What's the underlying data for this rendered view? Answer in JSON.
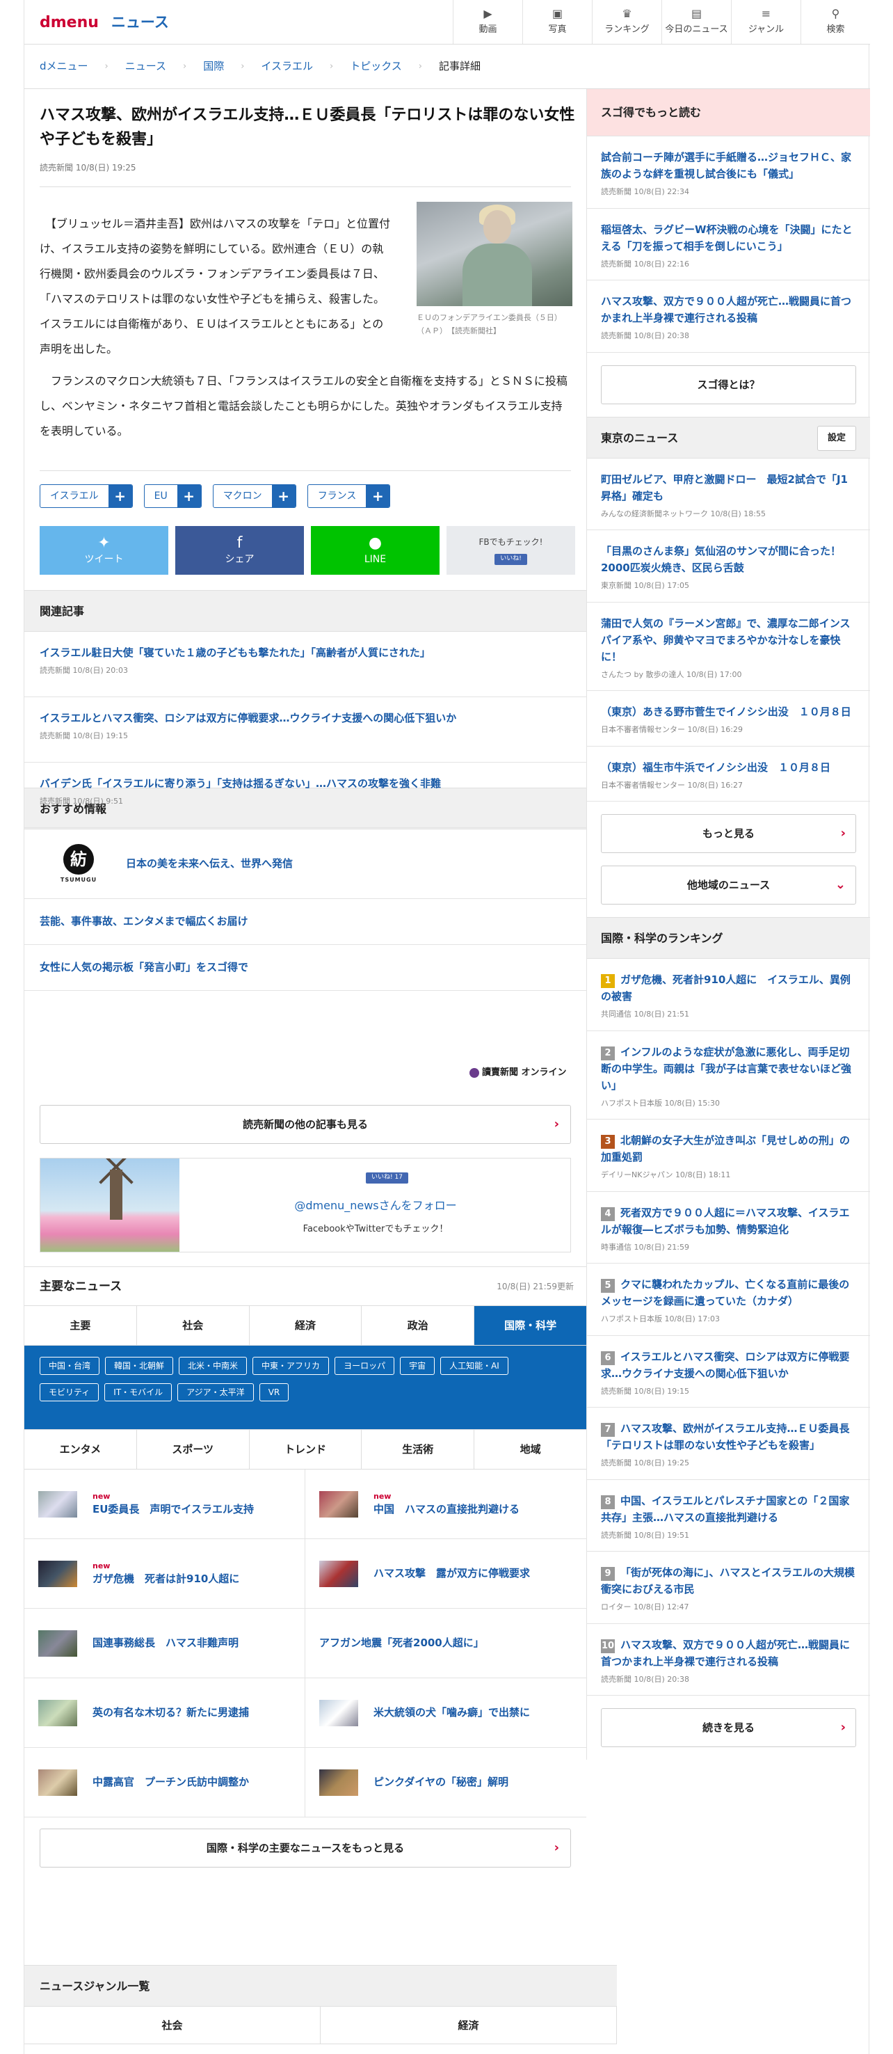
{
  "header": {
    "logo": "dmenu",
    "section": "ニュース",
    "nav": [
      {
        "label": "動画",
        "icon": "▶"
      },
      {
        "label": "写真",
        "icon": "▣"
      },
      {
        "label": "ランキング",
        "icon": "♛"
      },
      {
        "label": "今日のニュース",
        "icon": "▤"
      },
      {
        "label": "ジャンル",
        "icon": "≡"
      },
      {
        "label": "検索",
        "icon": "⚲"
      }
    ]
  },
  "breadcrumb": [
    "dメニュー",
    "ニュース",
    "国際",
    "イスラエル",
    "トピックス",
    "記事詳細"
  ],
  "article": {
    "title": "ハマス攻撃、欧州がイスラエル支持…ＥＵ委員長「テロリストは罪のない女性や子どもを殺害」",
    "meta": "読売新聞 10/8(日) 19:25",
    "p1": "　【ブリュッセル＝酒井圭吾】欧州はハマスの攻撃を「テロ」と位置付け、イスラエル支持の姿勢を鮮明にしている。欧州連合（ＥＵ）の執行機関・欧州委員会のウルズラ・フォンデアライエン委員長は７日、「ハマスのテロリストは罪のない女性や子どもを捕らえ、殺害した。イスラエルには自衛権があり、ＥＵはイスラエルとともにある」との声明を出した。",
    "caption": "ＥＵのフォンデアライエン委員長（５日）（ＡＰ）　【読売新聞社】",
    "p2": "　フランスのマクロン大統領も７日、「フランスはイスラエルの安全と自衛権を支持する」とＳＮＳに投稿し、ベンヤミン・ネタニヤフ首相と電話会談したことも明らかにした。英独やオランダもイスラエル支持を表明している。",
    "tags": [
      "イスラエル",
      "EU",
      "マクロン",
      "フランス"
    ]
  },
  "share": {
    "twitter": "ツイート",
    "facebook": "シェア",
    "line": "LINE",
    "fb_check": "FBでもチェック!",
    "fb_like": "いいね!"
  },
  "related": {
    "title": "関連記事",
    "items": [
      {
        "title": "イスラエル駐日大使「寝ていた１歳の子どもも撃たれた」「高齢者が人質にされた」",
        "meta": "読売新聞 10/8(日) 20:03"
      },
      {
        "title": "イスラエルとハマス衝突、ロシアは双方に停戦要求…ウクライナ支援への関心低下狙いか",
        "meta": "読売新聞 10/8(日) 19:15"
      },
      {
        "title": "バイデン氏「イスラエルに寄り添う」「支持は揺るぎない」…ハマスの攻撃を強く非難",
        "meta": "読売新聞 10/8(日) 9:51"
      }
    ]
  },
  "recommend": {
    "title": "おすすめ情報",
    "tsumugu": "紡",
    "tsumugu_word": "TSUMUGU",
    "items": [
      "日本の美を未来へ伝え、世界へ発信",
      "芸能、事件事故、エンタメまで幅広くお届け",
      "女性に人気の掲示板「発言小町」をスゴ得で"
    ],
    "yomiuri": "讀賣新聞 オンライン",
    "more": "読売新聞の他の記事も見る"
  },
  "follow": {
    "like": "いいね! 17",
    "handle": "@dmenu_newsさんをフォロー",
    "sub": "FacebookやTwitterでもチェック！"
  },
  "main_news": {
    "title": "主要なニュース",
    "updated": "10/8(日) 21:59更新",
    "tabs1": [
      "主要",
      "社会",
      "経済",
      "政治",
      "国際・科学"
    ],
    "subtags": [
      "中国・台湾",
      "韓国・北朝鮮",
      "北米・中南米",
      "中東・アフリカ",
      "ヨーロッパ",
      "宇宙",
      "人工知能・AI",
      "モビリティ",
      "IT・モバイル",
      "アジア・太平洋",
      "VR"
    ],
    "tabs2": [
      "エンタメ",
      "スポーツ",
      "トレンド",
      "生活術",
      "地域"
    ],
    "items": [
      {
        "title": "EU委員長　声明でイスラエル支持",
        "new": "new"
      },
      {
        "title": "中国　ハマスの直接批判避ける",
        "new": "new"
      },
      {
        "title": "ガザ危機　死者は計910人超に",
        "new": "new"
      },
      {
        "title": "ハマス攻撃　露が双方に停戦要求",
        "new": ""
      },
      {
        "title": "国連事務総長　ハマス非難声明",
        "new": ""
      },
      {
        "title": "アフガン地震「死者2000人超に」",
        "new": ""
      },
      {
        "title": "英の有名な木切る？新たに男逮捕",
        "new": ""
      },
      {
        "title": "米大統領の犬「噛み癖」で出禁に",
        "new": ""
      },
      {
        "title": "中露高官　プーチン氏訪中調整か",
        "new": ""
      },
      {
        "title": "ピンクダイヤの「秘密」解明",
        "new": ""
      }
    ],
    "more": "国際・科学の主要なニュースをもっと見る"
  },
  "side": {
    "sugo_title": "スゴ得でもっと読む",
    "sugo": [
      {
        "title": "試合前コーチ陣が選手に手紙贈る…ジョセフＨＣ、家族のような絆を重視し試合後にも「儀式」",
        "meta": "読売新聞 10/8(日) 22:34"
      },
      {
        "title": "稲垣啓太、ラグビーW杯決戦の心境を「決闘」にたとえる「刀を振って相手を倒しにいこう」",
        "meta": "読売新聞 10/8(日) 22:16"
      },
      {
        "title": "ハマス攻撃、双方で９００人超が死亡…戦闘員に首つかまれ上半身裸で連行される投稿",
        "meta": "読売新聞 10/8(日) 20:38"
      }
    ],
    "sugo_btn": "スゴ得とは？",
    "tokyo_title": "東京のニュース",
    "settings": "設定",
    "tokyo": [
      {
        "title": "町田ゼルビア、甲府と激闘ドロー　最短2試合で「J1昇格」確定も",
        "meta": "みんなの経済新聞ネットワーク 10/8(日) 18:55"
      },
      {
        "title": "「目黒のさんま祭」気仙沼のサンマが間に合った！　2000匹炭火焼き、区民ら舌鼓",
        "meta": "東京新聞 10/8(日) 17:05"
      },
      {
        "title": "蒲田で人気の『ラーメン宮郎』で、濃厚な二郎インスパイア系や、卵黄やマヨでまろやかな汁なしを豪快に！",
        "meta": "さんたつ by 散歩の達人 10/8(日) 17:00"
      },
      {
        "title": "（東京）あきる野市菅生でイノシシ出没　１０月８日",
        "meta": "日本不審者情報センター 10/8(日) 16:29"
      },
      {
        "title": "（東京）福生市牛浜でイノシシ出没　１０月８日",
        "meta": "日本不審者情報センター 10/8(日) 16:27"
      }
    ],
    "tokyo_more": "もっと見る",
    "other_region": "他地域のニュース",
    "rank_title": "国際・科学のランキング",
    "rank": [
      {
        "n": "1",
        "title": "ガザ危機、死者計910人超に　イスラエル、異例の被害",
        "meta": "共同通信 10/8(日) 21:51"
      },
      {
        "n": "2",
        "title": "インフルのような症状が急激に悪化し、両手足切断の中学生。両親は「我が子は言葉で表せないほど強い」",
        "meta": "ハフポスト日本版 10/8(日) 15:30"
      },
      {
        "n": "3",
        "title": "北朝鮮の女子大生が泣き叫ぶ「見せしめの刑」の加重処罰",
        "meta": "デイリーNKジャパン 10/8(日) 18:11"
      },
      {
        "n": "4",
        "title": "死者双方で９００人超に＝ハマス攻撃、イスラエルが報復―ヒズボラも加勢、情勢緊迫化",
        "meta": "時事通信 10/8(日) 21:59"
      },
      {
        "n": "5",
        "title": "クマに襲われたカップル、亡くなる直前に最後のメッセージを録画に遺っていた（カナダ）",
        "meta": "ハフポスト日本版 10/8(日) 17:03"
      },
      {
        "n": "6",
        "title": "イスラエルとハマス衝突、ロシアは双方に停戦要求…ウクライナ支援への関心低下狙いか",
        "meta": "読売新聞 10/8(日) 19:15"
      },
      {
        "n": "7",
        "title": "ハマス攻撃、欧州がイスラエル支持…ＥＵ委員長「テロリストは罪のない女性や子どもを殺害」",
        "meta": "読売新聞 10/8(日) 19:25"
      },
      {
        "n": "8",
        "title": "中国、イスラエルとパレスチナ国家との「２国家共存」主張…ハマスの直接批判避ける",
        "meta": "読売新聞 10/8(日) 19:51"
      },
      {
        "n": "9",
        "title": "「街が死体の海に」、ハマスとイスラエルの大規模衝突におびえる市民",
        "meta": "ロイター 10/8(日) 12:47"
      },
      {
        "n": "10",
        "title": "ハマス攻撃、双方で９００人超が死亡…戦闘員に首つかまれ上半身裸で連行される投稿",
        "meta": "読売新聞 10/8(日) 20:38"
      }
    ],
    "rank_more": "続きを見る"
  },
  "genre": {
    "title": "ニュースジャンル一覧",
    "tabs": [
      "社会",
      "経済"
    ]
  }
}
